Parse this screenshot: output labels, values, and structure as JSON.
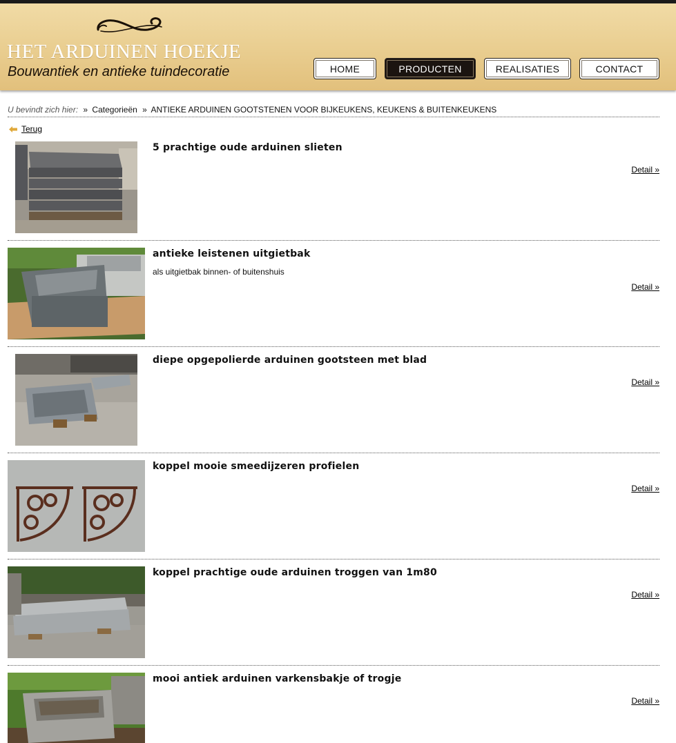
{
  "header": {
    "title": "HET ARDUINEN HOEKJE",
    "subtitle": "Bouwantiek en antieke tuindecoratie"
  },
  "nav": {
    "home": "HOME",
    "producten": "PRODUCTEN",
    "realisaties": "REALISATIES",
    "contact": "CONTACT",
    "active": "producten"
  },
  "breadcrumb": {
    "lead": "U bevindt zich hier:",
    "separator": "»",
    "items": [
      "Categorieën",
      "ANTIEKE ARDUINEN GOOTSTENEN VOOR BIJKEUKENS, KEUKENS & BUITENKEUKENS"
    ]
  },
  "back_label": "Terug",
  "products": [
    {
      "title": "5 prachtige oude arduinen slieten",
      "description": "",
      "detail": "Detail »",
      "image": "stacked-stone-slabs"
    },
    {
      "title": "antieke leistenen uitgietbak",
      "description": "als uitgietbak binnen- of buitenshuis",
      "detail": "Detail »",
      "image": "slate-sink"
    },
    {
      "title": "diepe opgepolierde arduinen gootsteen met blad",
      "description": "",
      "detail": "Detail »",
      "image": "stone-sink-with-drainboard"
    },
    {
      "title": "koppel mooie smeedijzeren profielen",
      "description": "",
      "detail": "Detail »",
      "image": "wrought-iron-brackets"
    },
    {
      "title": "koppel prachtige oude arduinen troggen van 1m80",
      "description": "",
      "detail": "Detail »",
      "image": "long-stone-troughs"
    },
    {
      "title": "mooi antiek arduinen varkensbakje of trogje",
      "description": "",
      "detail": "Detail »",
      "image": "small-stone-trough"
    }
  ],
  "colors": {
    "header_gold": "#e9cd8f",
    "nav_active_bg": "#1b1410",
    "text": "#111111"
  }
}
